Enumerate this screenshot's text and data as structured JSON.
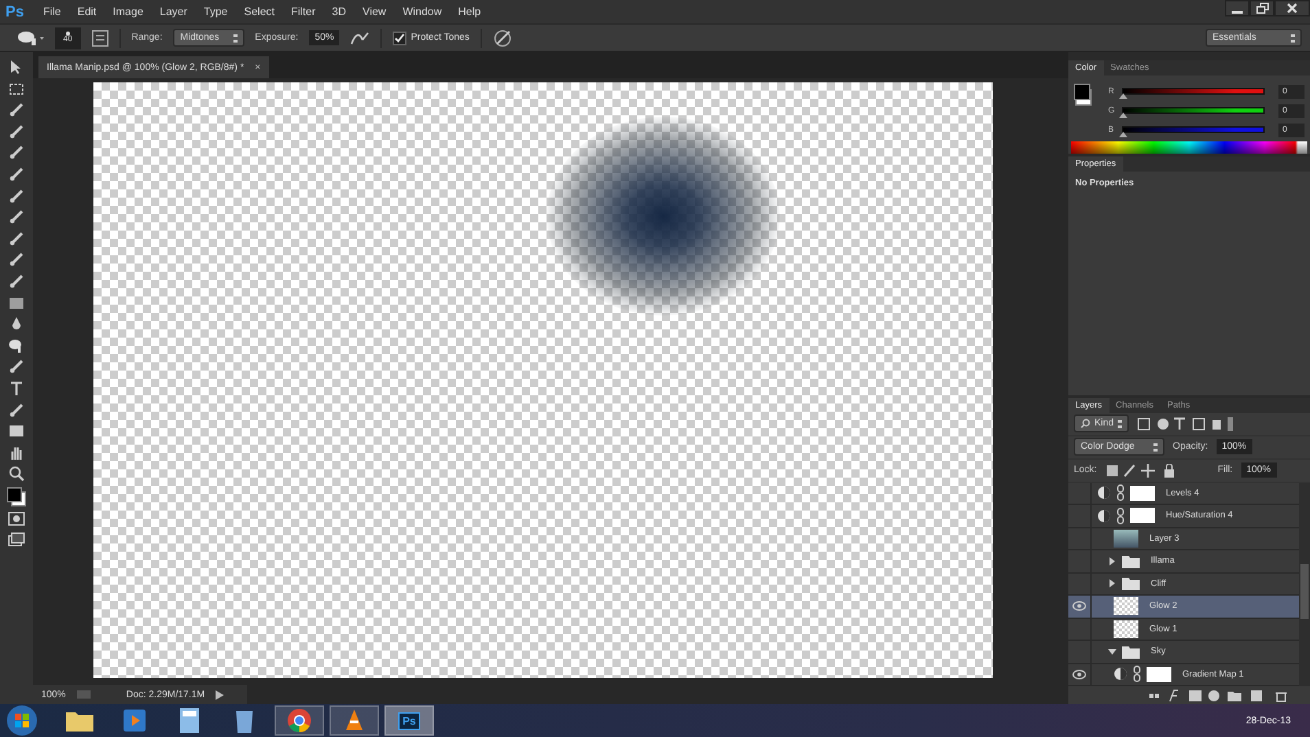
{
  "app_logo": "Ps",
  "menu": [
    "File",
    "Edit",
    "Image",
    "Layer",
    "Type",
    "Select",
    "Filter",
    "3D",
    "View",
    "Window",
    "Help"
  ],
  "options_bar": {
    "brush_size": "40",
    "range_label": "Range:",
    "range_value": "Midtones",
    "exposure_label": "Exposure:",
    "exposure_value": "50%",
    "protect_tones": {
      "label": "Protect Tones",
      "checked": true
    },
    "workspace": "Essentials"
  },
  "document_tab": {
    "title": "Illama Manip.psd @ 100% (Glow 2, RGB/8#) *",
    "close": "×"
  },
  "color_panel": {
    "tabs": [
      {
        "label": "Color",
        "selected": true
      },
      {
        "label": "Swatches",
        "selected": false
      }
    ],
    "channels": [
      {
        "name": "R",
        "value": "0",
        "level": 0,
        "color": "#e01010"
      },
      {
        "name": "G",
        "value": "0",
        "level": 0,
        "color": "#10d010"
      },
      {
        "name": "B",
        "value": "0",
        "level": 0,
        "color": "#1010e0"
      }
    ]
  },
  "properties_panel": {
    "title": "Properties",
    "message": "No Properties"
  },
  "layers_panel": {
    "tabs": [
      {
        "label": "Layers",
        "selected": true
      },
      {
        "label": "Channels",
        "selected": false
      },
      {
        "label": "Paths",
        "selected": false
      }
    ],
    "filter": "Kind",
    "blend_mode": "Color Dodge",
    "opacity_label": "Opacity:",
    "opacity": "100%",
    "lock_label": "Lock:",
    "fill_label": "Fill:",
    "fill": "100%",
    "layers": [
      {
        "name": "Levels 4",
        "kind": "adjustment",
        "visible": false,
        "selected": false
      },
      {
        "name": "Hue/Saturation 4",
        "kind": "adjustment",
        "visible": false,
        "selected": false
      },
      {
        "name": "Layer 3",
        "kind": "photo",
        "visible": false,
        "selected": false
      },
      {
        "name": "Illama",
        "kind": "group",
        "visible": false,
        "selected": false,
        "expanded": false
      },
      {
        "name": "Cliff",
        "kind": "group",
        "visible": false,
        "selected": false,
        "expanded": false
      },
      {
        "name": "Glow 2",
        "kind": "pixel",
        "visible": true,
        "selected": true
      },
      {
        "name": "Glow 1",
        "kind": "pixel",
        "visible": false,
        "selected": false
      },
      {
        "name": "Sky",
        "kind": "group",
        "visible": false,
        "selected": false,
        "expanded": true,
        "children": [
          {
            "name": "Gradient Map 1",
            "kind": "adjustment",
            "visible": true,
            "selected": false
          }
        ]
      }
    ]
  },
  "status_bar": {
    "zoom": "100%",
    "doc_size": "Doc: 2.29M/17.1M"
  },
  "taskbar": {
    "apps": [
      {
        "kind": "folder",
        "running": false,
        "selected": false
      },
      {
        "kind": "media",
        "running": false,
        "selected": false
      },
      {
        "kind": "calculator",
        "running": false,
        "selected": false
      },
      {
        "kind": "bin",
        "running": false,
        "selected": false
      },
      {
        "kind": "browser",
        "running": true,
        "selected": false
      },
      {
        "kind": "cone",
        "running": true,
        "selected": false
      },
      {
        "kind": "ps",
        "running": true,
        "selected": true,
        "label": "Ps"
      }
    ],
    "date": "28-Dec-13"
  }
}
